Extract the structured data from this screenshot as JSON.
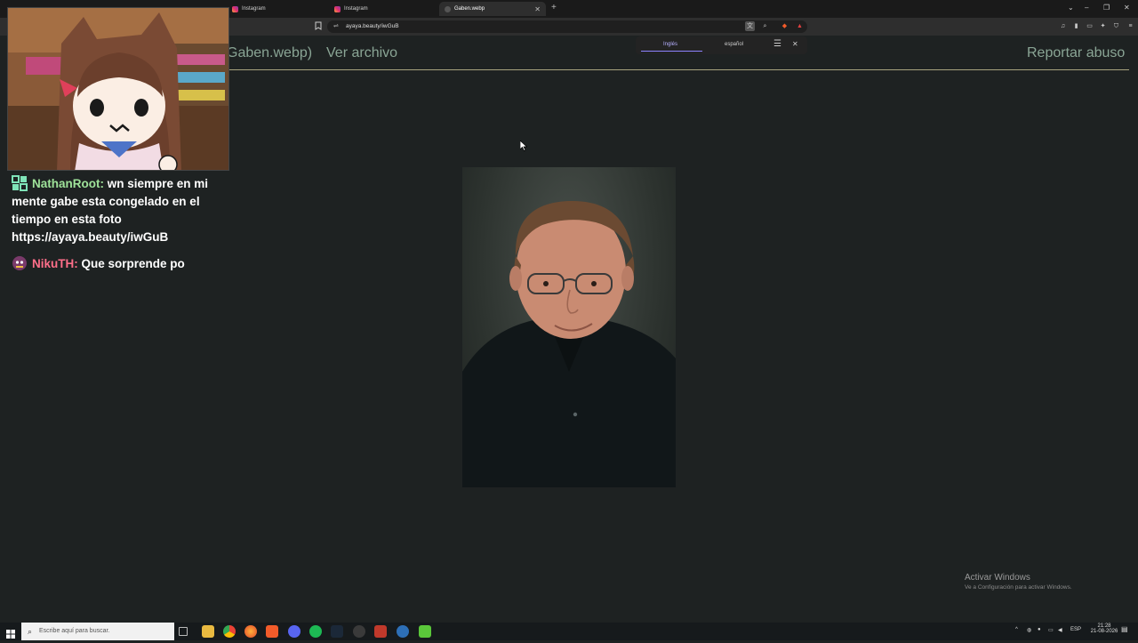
{
  "browser": {
    "tabs": [
      {
        "label": "Instagram",
        "active": false
      },
      {
        "label": "Instagram",
        "active": false
      },
      {
        "label": "Gaben.webp",
        "active": true
      }
    ],
    "url": "ayaya.beauty/iwGuB",
    "translate": {
      "from": "Inglés",
      "to": "español"
    }
  },
  "page": {
    "filename": "Gaben.webp)",
    "view_file": "Ver archivo",
    "report": "Reportar abuso"
  },
  "chat": [
    {
      "user": "NathanRoot:",
      "lines": [
        "wn siempre en mi",
        "mente gabe esta congelado en el",
        "tiempo en esta foto",
        "https://ayaya.beauty/iwGuB"
      ]
    },
    {
      "user": "NikuTH:",
      "lines": [
        "Que sorprende po"
      ]
    }
  ],
  "windows": {
    "activate_title": "Activar Windows",
    "activate_sub": "Ve a Configuración para activar Windows."
  },
  "taskbar": {
    "search_placeholder": "Escribe aquí para buscar.",
    "lang": "ESP",
    "time": "21:28",
    "date": "21-08-2026"
  },
  "colors": {
    "accent_text": "#8aa595",
    "header_line": "#a8a37f",
    "page_bg": "#1e2222"
  }
}
